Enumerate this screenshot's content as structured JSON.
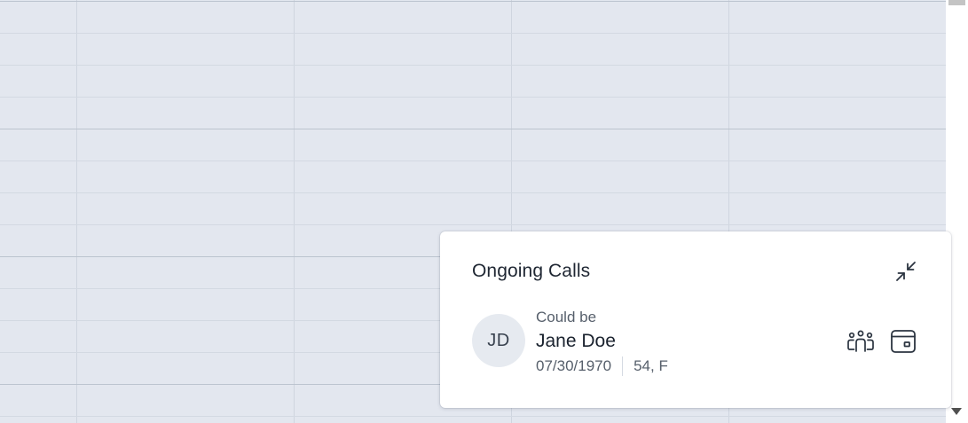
{
  "ongoing_calls": {
    "title": "Ongoing Calls",
    "minimize_icon": "collapse-icon",
    "call": {
      "avatar_initials": "JD",
      "match_hint": "Could be",
      "caller_name": "Jane Doe",
      "date_of_birth": "07/30/1970",
      "age_sex": "54, F",
      "group_icon": "people-group-icon",
      "open_icon": "window-icon"
    }
  },
  "colors": {
    "background": "#e3e7ef",
    "card": "#ffffff",
    "text_primary": "#1f2733",
    "text_secondary": "#565f6b"
  }
}
